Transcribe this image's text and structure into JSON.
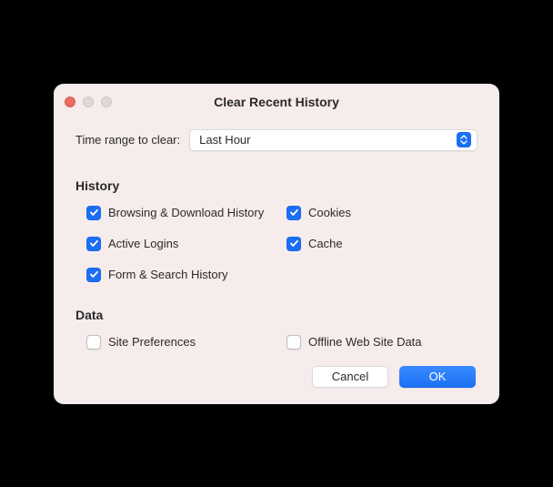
{
  "window": {
    "title": "Clear Recent History"
  },
  "range": {
    "label": "Time range to clear:",
    "value": "Last Hour"
  },
  "sections": {
    "history_title": "History",
    "data_title": "Data"
  },
  "checkboxes": {
    "browsing": "Browsing & Download History",
    "cookies": "Cookies",
    "activelogins": "Active Logins",
    "cache": "Cache",
    "formsearch": "Form & Search History",
    "siteprefs": "Site Preferences",
    "offlinedata": "Offline Web Site Data"
  },
  "buttons": {
    "cancel": "Cancel",
    "ok": "OK"
  },
  "colors": {
    "accent": "#1a6ff4",
    "window_bg": "#f7ecec"
  }
}
